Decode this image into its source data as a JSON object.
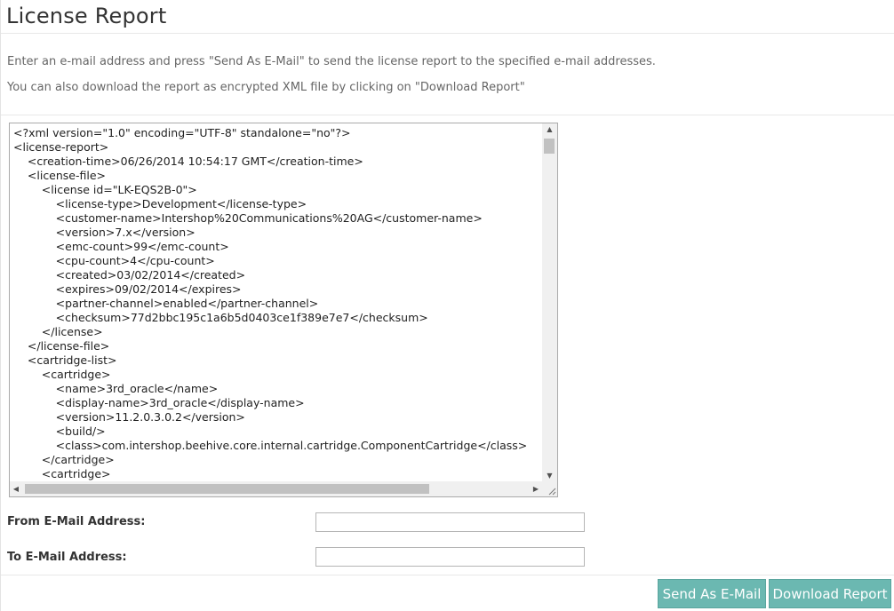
{
  "page": {
    "title": "License Report"
  },
  "intro": {
    "line1": "Enter an e-mail address and press \"Send As E-Mail\" to send the license report to the specified e-mail addresses.",
    "line2": "You can also download the report as encrypted XML file by clicking on \"Download Report\""
  },
  "report": {
    "lines": [
      "<?xml version=\"1.0\" encoding=\"UTF-8\" standalone=\"no\"?>",
      "<license-report>",
      "    <creation-time>06/26/2014 10:54:17 GMT</creation-time>",
      "    <license-file>",
      "        <license id=\"LK-EQS2B-0\">",
      "            <license-type>Development</license-type>",
      "            <customer-name>Intershop%20Communications%20AG</customer-name>",
      "            <version>7.x</version>",
      "            <emc-count>99</emc-count>",
      "            <cpu-count>4</cpu-count>",
      "            <created>03/02/2014</created>",
      "            <expires>09/02/2014</expires>",
      "            <partner-channel>enabled</partner-channel>",
      "            <checksum>77d2bbc195c1a6b5d0403ce1f389e7e7</checksum>",
      "        </license>",
      "    </license-file>",
      "    <cartridge-list>",
      "        <cartridge>",
      "            <name>3rd_oracle</name>",
      "            <display-name>3rd_oracle</display-name>",
      "            <version>11.2.0.3.0.2</version>",
      "            <build/>",
      "            <class>com.intershop.beehive.core.internal.cartridge.ComponentCartridge</class>",
      "        </cartridge>",
      "        <cartridge>"
    ]
  },
  "form": {
    "from_label": "From E-Mail Address:",
    "from_value": "",
    "to_label": "To E-Mail Address:",
    "to_value": ""
  },
  "actions": {
    "send_label": "Send As E-Mail",
    "download_label": "Download Report"
  },
  "colors": {
    "button_bg": "#6bb8b1",
    "button_text": "#ffffff"
  }
}
